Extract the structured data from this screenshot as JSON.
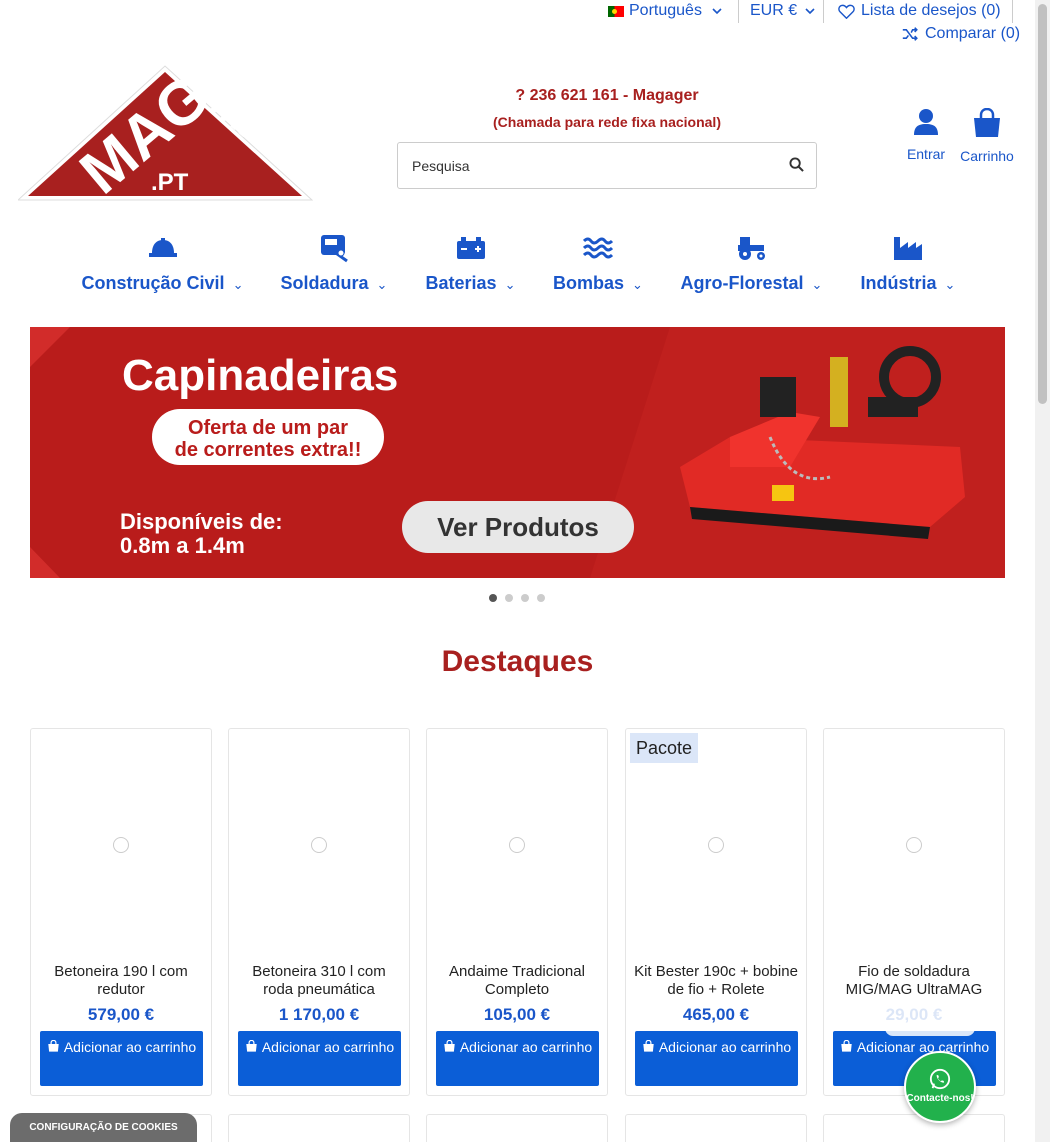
{
  "topbar": {
    "language": "Português",
    "currency": "EUR €",
    "wishlist": "Lista de desejos (0)",
    "compare": "Comparar (0)"
  },
  "header": {
    "logo_text": "MAG MAG .PT",
    "phone": "? 236 621 161 - Magager",
    "phone_note": "(Chamada para rede fixa nacional)",
    "search_placeholder": "Pesquisa",
    "account_label": "Entrar",
    "cart_label": "Carrinho"
  },
  "nav": {
    "items": [
      {
        "label": "Construção Civil",
        "icon": "helmet-icon"
      },
      {
        "label": "Soldadura",
        "icon": "welding-icon"
      },
      {
        "label": "Baterias",
        "icon": "battery-icon"
      },
      {
        "label": "Bombas",
        "icon": "water-icon"
      },
      {
        "label": "Agro-Florestal",
        "icon": "tractor-icon"
      },
      {
        "label": "Indústria",
        "icon": "industry-icon"
      }
    ]
  },
  "banner": {
    "title": "Capinadeiras",
    "offer_line1": "Oferta de um par",
    "offer_line2": "de correntes extra!!",
    "avail_line1": "Disponíveis de:",
    "avail_line2": "0.8m a 1.4m",
    "cta": "Ver Produtos",
    "slides": 4,
    "active_slide": 1
  },
  "featured": {
    "title": "Destaques",
    "add_label": "Adicionar ao carrinho",
    "products": [
      {
        "name": "Betoneira 190 l com redutor",
        "price": "579,00 €",
        "badge": ""
      },
      {
        "name": "Betoneira 310 l com roda pneumática",
        "price": "1 170,00 €",
        "badge": ""
      },
      {
        "name": "Andaime Tradicional Completo",
        "price": "105,00 €",
        "badge": ""
      },
      {
        "name": "Kit Bester 190c + bobine de fio + Rolete",
        "price": "465,00 €",
        "badge": "Pacote"
      },
      {
        "name": "Fio de soldadura MIG/MAG UltraMAG",
        "price": "29,00 €",
        "badge": ""
      }
    ]
  },
  "cookie": "CONFIGURAÇÃO DE COOKIES",
  "whatsapp": "Contacte-nos!",
  "colors": {
    "brand_red": "#a8201f",
    "link_blue": "#1a56c9",
    "button_blue": "#0b5ed7",
    "whatsapp_green": "#22b14c"
  }
}
